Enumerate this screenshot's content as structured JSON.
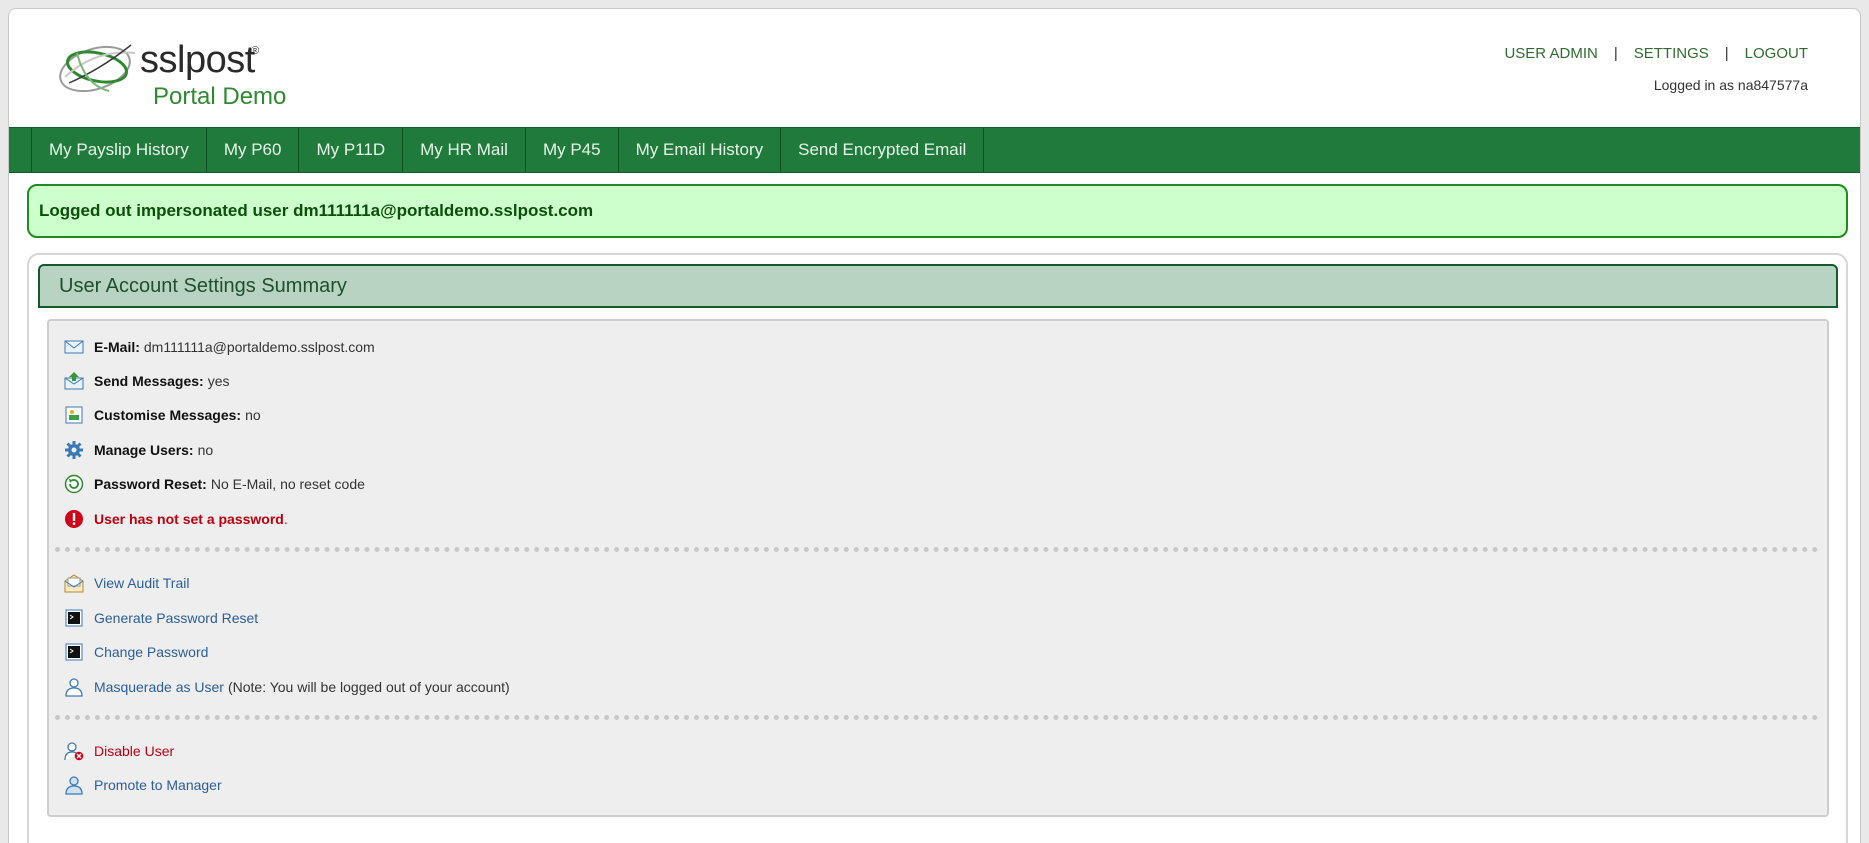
{
  "brand": {
    "name": "sslpost",
    "reg_mark": "®",
    "subtitle": "Portal Demo"
  },
  "topnav": {
    "items": [
      "USER ADMIN",
      "SETTINGS",
      "LOGOUT"
    ],
    "separator": "|"
  },
  "logged_in_text": "Logged in as na847577a",
  "mainnav": {
    "items": [
      "My Payslip History",
      "My P60",
      "My P11D",
      "My HR Mail",
      "My P45",
      "My Email History",
      "Send Encrypted Email"
    ]
  },
  "notice": "Logged out impersonated user dm111111a@portaldemo.sslpost.com",
  "panel": {
    "title": "User Account Settings Summary",
    "details": [
      {
        "label": "E-Mail:",
        "value": "dm111111a@portaldemo.sslpost.com",
        "icon": "envelope-icon"
      },
      {
        "label": "Send Messages:",
        "value": "yes",
        "icon": "send-mail-icon"
      },
      {
        "label": "Customise Messages:",
        "value": "no",
        "icon": "image-icon"
      },
      {
        "label": "Manage Users:",
        "value": "no",
        "icon": "gear-icon"
      },
      {
        "label": "Password Reset:",
        "value": "No E-Mail, no reset code",
        "icon": "refresh-icon"
      }
    ],
    "warning": {
      "text": "User has not set a password",
      "suffix": ".",
      "icon": "alert-icon"
    },
    "actions": [
      {
        "label": "View Audit Trail",
        "icon": "open-envelope-icon"
      },
      {
        "label": "Generate Password Reset",
        "icon": "terminal-icon"
      },
      {
        "label": "Change Password",
        "icon": "terminal-icon"
      },
      {
        "label": "Masquerade as User",
        "note": "(Note: You will be logged out of your account)",
        "icon": "user-icon"
      }
    ],
    "admin_actions": [
      {
        "label": "Disable User",
        "icon": "user-disable-icon"
      },
      {
        "label": "Promote to Manager",
        "icon": "user-icon"
      }
    ]
  },
  "colors": {
    "nav_green": "#1f7a3c",
    "notice_bg": "#ccffcc",
    "panel_head_bg": "#b8d3c2",
    "link_blue": "#2b5d9a",
    "warning_red": "#c00010"
  }
}
